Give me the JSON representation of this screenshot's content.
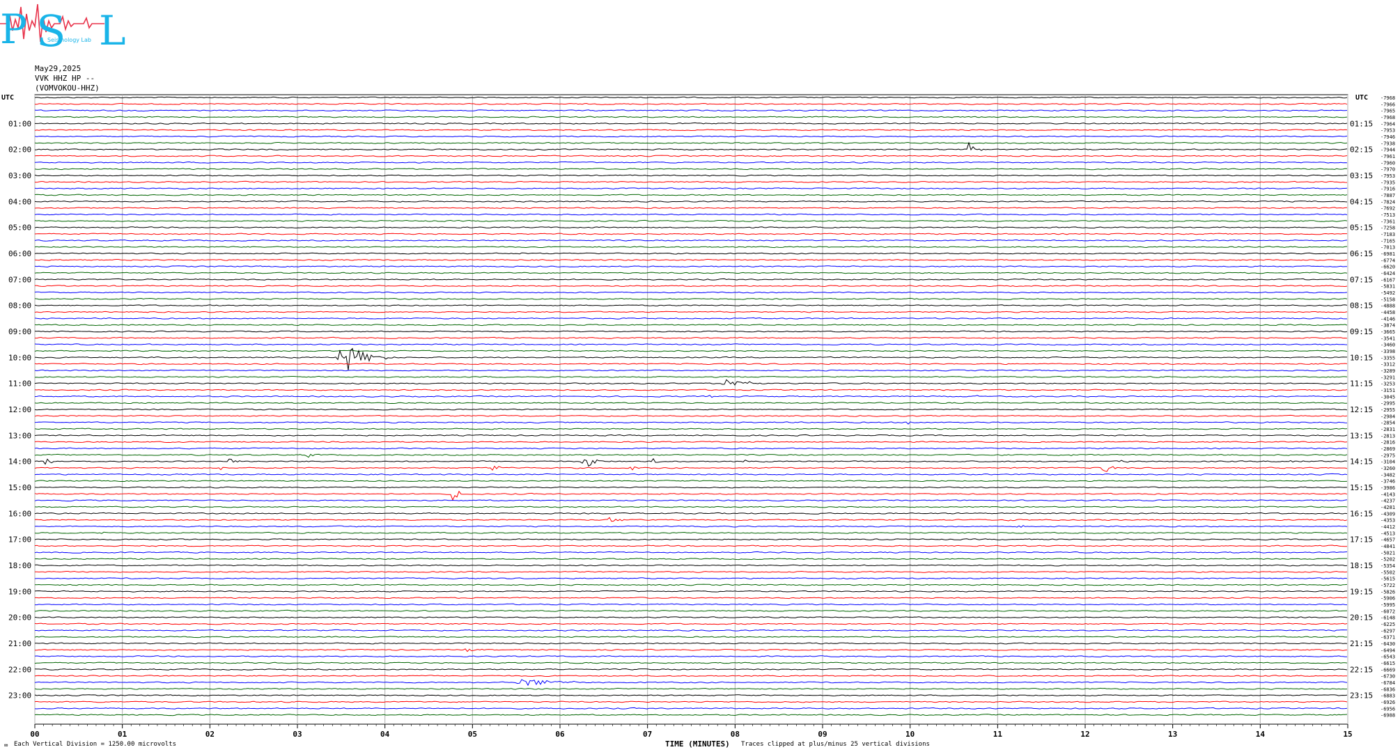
{
  "logo": {
    "big_letters": [
      "P",
      "S",
      "L"
    ],
    "small_text": "Seismology Lab"
  },
  "header": {
    "date": "May29,2025",
    "station": "VVK HHZ HP --",
    "code": "(VOMVOKOU-HHZ)"
  },
  "footer": {
    "scale": "Each Vertical Division = 1250.00 microvolts",
    "xlabel": "TIME (MINUTES)",
    "clip": "Traces clipped at plus/minus 25 vertical divisions"
  },
  "colors": {
    "trace_cycle": [
      "#000000",
      "#ff0000",
      "#0000ff",
      "#006400"
    ],
    "grid": "#b0b0b0"
  },
  "chart_data": {
    "type": "line",
    "title": "",
    "xlabel": "TIME (MINUTES)",
    "xlim": [
      0,
      15
    ],
    "x_ticks": [
      "00",
      "01",
      "02",
      "03",
      "04",
      "05",
      "06",
      "07",
      "08",
      "09",
      "10",
      "11",
      "12",
      "13",
      "14",
      "15"
    ],
    "trace_count": 96,
    "minutes_per_trace": 15,
    "left_axis_label": "UTC",
    "right_axis_label": "UTC",
    "left_hour_labels": [
      "01:00",
      "02:00",
      "03:00",
      "04:00",
      "05:00",
      "06:00",
      "07:00",
      "08:00",
      "09:00",
      "10:00",
      "11:00",
      "12:00",
      "13:00",
      "14:00",
      "15:00",
      "16:00",
      "17:00",
      "18:00",
      "19:00",
      "20:00",
      "21:00",
      "22:00",
      "23:00"
    ],
    "right_hour_labels": [
      "01:15",
      "02:15",
      "03:15",
      "04:15",
      "05:15",
      "06:15",
      "07:15",
      "08:15",
      "09:15",
      "10:15",
      "11:15",
      "12:15",
      "13:15",
      "14:15",
      "15:15",
      "16:15",
      "17:15",
      "18:15",
      "19:15",
      "20:15",
      "21:15",
      "22:15",
      "23:15"
    ],
    "right_values": [
      -7968,
      -7966,
      -7965,
      -7968,
      -7964,
      -7953,
      -7946,
      -7938,
      -7944,
      -7961,
      -7960,
      -7970,
      -7953,
      -7935,
      -7916,
      -7887,
      -7824,
      -7692,
      -7513,
      -7361,
      -7258,
      -7183,
      -7165,
      -7013,
      -6981,
      -6774,
      -6620,
      -6424,
      -6167,
      -5831,
      -5492,
      -5158,
      -4888,
      -4458,
      -4146,
      -3874,
      -3665,
      -3541,
      -3460,
      -3398,
      -3355,
      -3312,
      -3289,
      -3291,
      -3253,
      -3151,
      -3045,
      -2995,
      -2955,
      -2984,
      -2854,
      -2831,
      -2813,
      -2816,
      -2869,
      -2975,
      -3104,
      -3260,
      -3482,
      -3746,
      -3986,
      -4143,
      -4237,
      -4281,
      -4309,
      -4353,
      -4412,
      -4513,
      -4657,
      -4841,
      -5021,
      -5202,
      -5354,
      -5502,
      -5615,
      -5722,
      -5826,
      -5906,
      -5995,
      -6072,
      -6148,
      -6225,
      -6297,
      -6371,
      -6430,
      -6494,
      -6543,
      -6615,
      -6669,
      -6730,
      -6784,
      -6836,
      -6883,
      -6926,
      -6956,
      -6988
    ],
    "events": [
      {
        "trace": 7,
        "start_min": 4.35,
        "duration_min": 0.1,
        "amplitude": 4
      },
      {
        "trace": 8,
        "start_min": 10.65,
        "duration_min": 0.2,
        "amplitude": 16
      },
      {
        "trace": 24,
        "start_min": 5.55,
        "duration_min": 0.1,
        "amplitude": 4
      },
      {
        "trace": 40,
        "start_min": 3.45,
        "duration_min": 0.7,
        "amplitude": 40
      },
      {
        "trace": 44,
        "start_min": 7.85,
        "duration_min": 0.7,
        "amplitude": 10
      },
      {
        "trace": 46,
        "start_min": 7.7,
        "duration_min": 0.1,
        "amplitude": 4
      },
      {
        "trace": 46,
        "start_min": 10.75,
        "duration_min": 0.2,
        "amplitude": 4
      },
      {
        "trace": 50,
        "start_min": 9.95,
        "duration_min": 0.3,
        "amplitude": 4
      },
      {
        "trace": 50,
        "start_min": 10.6,
        "duration_min": 0.25,
        "amplitude": 4
      },
      {
        "trace": 54,
        "start_min": 12.2,
        "duration_min": 0.1,
        "amplitude": 4
      },
      {
        "trace": 55,
        "start_min": 3.1,
        "duration_min": 0.2,
        "amplitude": 6
      },
      {
        "trace": 55,
        "start_min": 11.8,
        "duration_min": 0.2,
        "amplitude": 3
      },
      {
        "trace": 56,
        "start_min": 0.1,
        "duration_min": 0.3,
        "amplitude": 7
      },
      {
        "trace": 56,
        "start_min": 2.2,
        "duration_min": 0.4,
        "amplitude": 5
      },
      {
        "trace": 56,
        "start_min": 6.25,
        "duration_min": 0.5,
        "amplitude": 12
      },
      {
        "trace": 56,
        "start_min": 7.05,
        "duration_min": 0.2,
        "amplitude": 5
      },
      {
        "trace": 56,
        "start_min": 8.1,
        "duration_min": 0.1,
        "amplitude": 6
      },
      {
        "trace": 56,
        "start_min": 12.4,
        "duration_min": 0.2,
        "amplitude": 5
      },
      {
        "trace": 56,
        "start_min": 14.3,
        "duration_min": 0.3,
        "amplitude": 7
      },
      {
        "trace": 57,
        "start_min": 2.1,
        "duration_min": 0.1,
        "amplitude": 6
      },
      {
        "trace": 57,
        "start_min": 5.2,
        "duration_min": 0.5,
        "amplitude": 5
      },
      {
        "trace": 57,
        "start_min": 6.8,
        "duration_min": 0.3,
        "amplitude": 5
      },
      {
        "trace": 57,
        "start_min": 12.15,
        "duration_min": 0.4,
        "amplitude": 14
      },
      {
        "trace": 61,
        "start_min": 4.75,
        "duration_min": 0.35,
        "amplitude": 12
      },
      {
        "trace": 65,
        "start_min": 6.55,
        "duration_min": 0.35,
        "amplitude": 9
      },
      {
        "trace": 65,
        "start_min": 11.1,
        "duration_min": 0.25,
        "amplitude": 4
      },
      {
        "trace": 65,
        "start_min": 14.95,
        "duration_min": 0.05,
        "amplitude": 6
      },
      {
        "trace": 66,
        "start_min": 1.85,
        "duration_min": 0.1,
        "amplitude": 4
      },
      {
        "trace": 66,
        "start_min": 3.65,
        "duration_min": 0.15,
        "amplitude": 4
      },
      {
        "trace": 66,
        "start_min": 6.15,
        "duration_min": 0.1,
        "amplitude": 4
      },
      {
        "trace": 66,
        "start_min": 11.2,
        "duration_min": 0.3,
        "amplitude": 5
      },
      {
        "trace": 67,
        "start_min": 0.75,
        "duration_min": 0.1,
        "amplitude": 4
      },
      {
        "trace": 85,
        "start_min": 4.9,
        "duration_min": 0.4,
        "amplitude": 3
      },
      {
        "trace": 90,
        "start_min": 5.5,
        "duration_min": 1.2,
        "amplitude": 9
      }
    ]
  }
}
